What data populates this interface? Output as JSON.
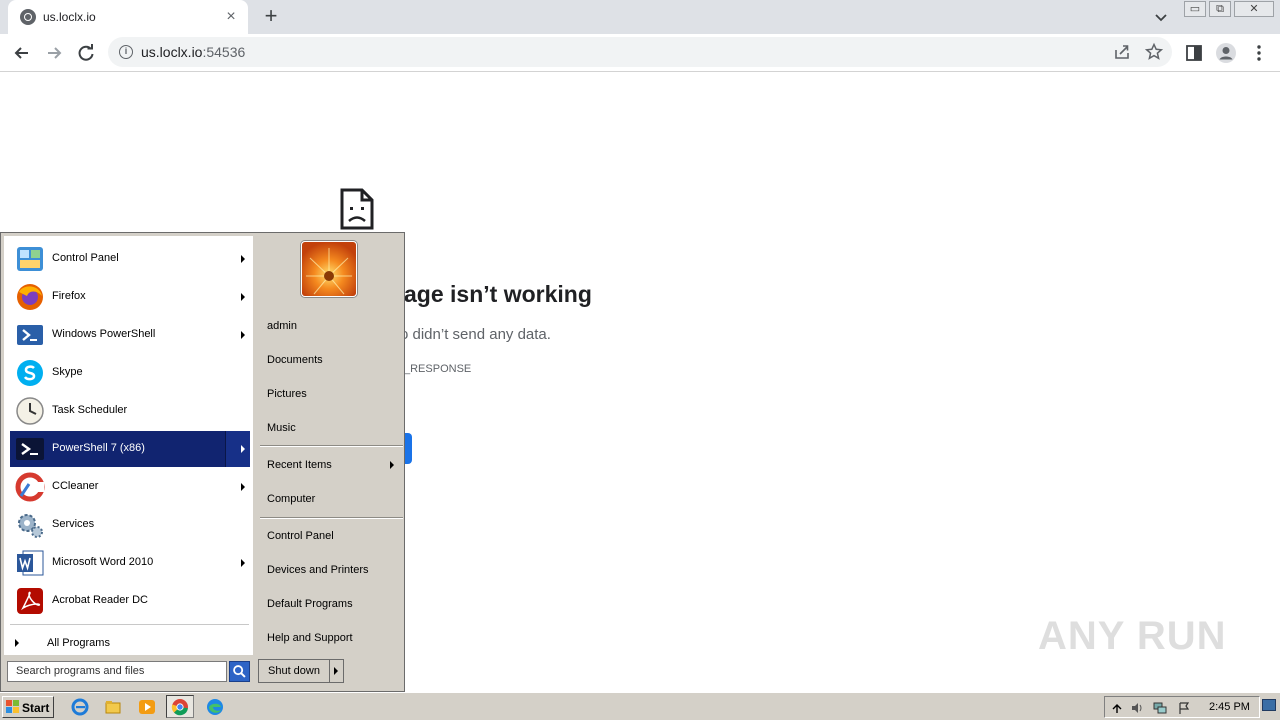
{
  "browser": {
    "tab": {
      "title": "us.loclx.io",
      "close_icon": "close-icon"
    },
    "new_tab_label": "+",
    "url_host": "us.loclx.io",
    "url_port": ":54536",
    "window_buttons": {
      "minimize": "▭",
      "restore": "⧉",
      "close": "✕"
    }
  },
  "error_page": {
    "title": "age isn’t working",
    "description": "o didn’t send any data.",
    "code": "_RESPONSE"
  },
  "start_menu": {
    "left_items": [
      {
        "label": "Control Panel",
        "icon": "control-panel-icon",
        "has_arrow": true
      },
      {
        "label": "Firefox",
        "icon": "firefox-icon",
        "has_arrow": true
      },
      {
        "label": "Windows PowerShell",
        "icon": "powershell-icon",
        "has_arrow": true
      },
      {
        "label": "Skype",
        "icon": "skype-icon",
        "has_arrow": false
      },
      {
        "label": "Task Scheduler",
        "icon": "task-scheduler-icon",
        "has_arrow": false
      },
      {
        "label": "PowerShell 7 (x86)",
        "icon": "powershell7-icon",
        "has_arrow": true,
        "active": true
      },
      {
        "label": "CCleaner",
        "icon": "ccleaner-icon",
        "has_arrow": true
      },
      {
        "label": "Services",
        "icon": "services-icon",
        "has_arrow": false
      },
      {
        "label": "Microsoft Word 2010",
        "icon": "word-icon",
        "has_arrow": true
      },
      {
        "label": "Acrobat Reader DC",
        "icon": "acrobat-icon",
        "has_arrow": false
      }
    ],
    "all_programs": "All Programs",
    "search_placeholder": "Search programs and files",
    "right_items": [
      {
        "label": "admin"
      },
      {
        "label": "Documents"
      },
      {
        "label": "Pictures"
      },
      {
        "label": "Music"
      },
      {
        "label": "Recent Items",
        "has_arrow": true
      },
      {
        "label": "Computer"
      },
      {
        "label": "Control Panel"
      },
      {
        "label": "Devices and Printers"
      },
      {
        "label": "Default Programs"
      },
      {
        "label": "Help and Support"
      }
    ],
    "shutdown_label": "Shut down"
  },
  "taskbar": {
    "start_label": "Start",
    "clock": "2:45 PM"
  },
  "watermark": "ANY RUN",
  "colors": {
    "menu_highlight": "#112470",
    "chrome_blue": "#1a73e8",
    "taskbar_bg": "#d4d0c8"
  }
}
